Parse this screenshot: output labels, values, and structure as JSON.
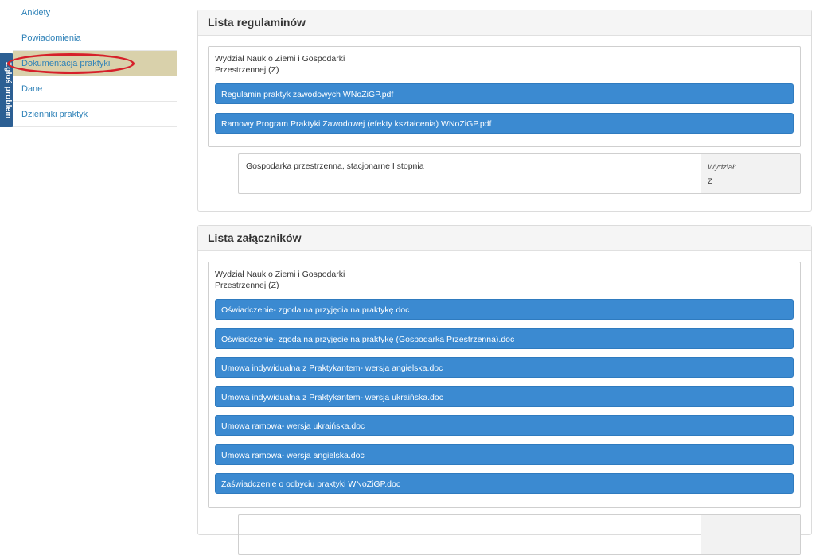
{
  "sidebar": {
    "items": [
      {
        "label": "Ankiety"
      },
      {
        "label": "Powiadomienia"
      },
      {
        "label": "Dokumentacja praktyki"
      },
      {
        "label": "Dane"
      },
      {
        "label": "Dzienniki praktyk"
      }
    ],
    "active_index": 2,
    "report_tab": "Zgłoś problem"
  },
  "regulations": {
    "title": "Lista regulaminów",
    "faculty": "Wydział Nauk o Ziemi i Gospodarki Przestrzennej (Z)",
    "files": [
      "Regulamin praktyk zawodowych WNoZiGP.pdf",
      "Ramowy Program Praktyki Zawodowej (efekty kształcenia) WNoZiGP.pdf"
    ],
    "program": {
      "name": "Gospodarka przestrzenna, stacjonarne I stopnia",
      "faculty_label": "Wydział:",
      "faculty_value": "Z"
    }
  },
  "attachments": {
    "title": "Lista załączników",
    "faculty": "Wydział Nauk o Ziemi i Gospodarki Przestrzennej (Z)",
    "files": [
      "Oświadczenie- zgoda na przyjęcia na praktykę.doc",
      "Oświadczenie- zgoda na przyjęcie na praktykę (Gospodarka Przestrzenna).doc",
      "Umowa indywidualna z Praktykantem- wersja angielska.doc",
      "Umowa indywidualna z Praktykantem- wersja ukraińska.doc",
      "Umowa ramowa- wersja ukraińska.doc",
      "Umowa ramowa- wersja angielska.doc",
      "Zaświadczenie o odbyciu praktyki WNoZiGP.doc"
    ]
  },
  "colors": {
    "accent": "#3b8ad1",
    "link": "#2f82b8",
    "active_bg": "#d9d1ab",
    "highlight": "#d6202a",
    "report_tab": "#2c5f93"
  }
}
